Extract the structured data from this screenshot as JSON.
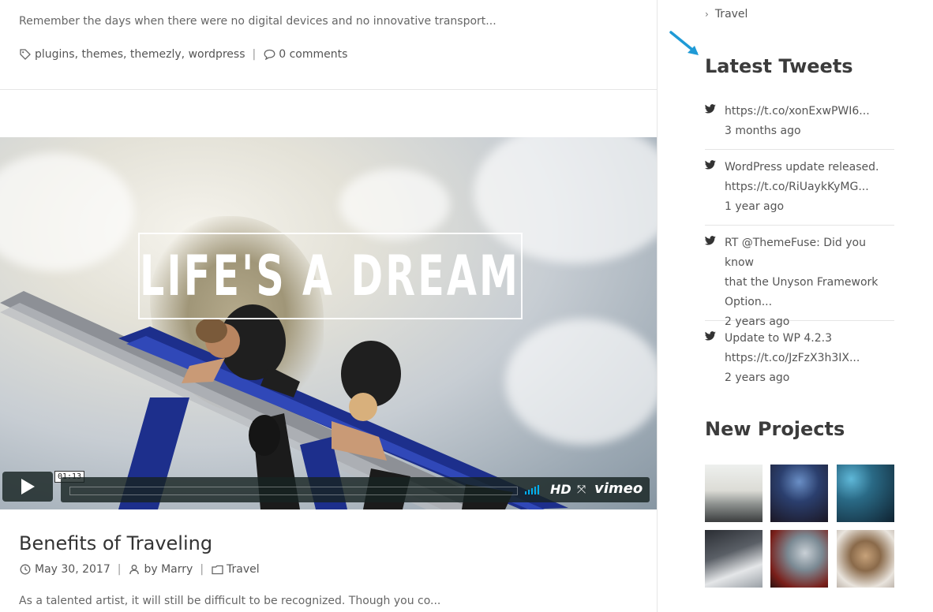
{
  "top_post": {
    "excerpt": "Remember the days when there were no digital devices and no innovative transport...",
    "tags": "plugins, themes, themezly, wordpress",
    "comments": "0 comments"
  },
  "video": {
    "overlay_title": "LIFE'S A DREAM",
    "timecode": "01:13",
    "hd_label": "HD",
    "brand": "vimeo"
  },
  "post": {
    "title": "Benefits of Traveling",
    "date": "May 30, 2017",
    "author": "by Marry",
    "category": "Travel",
    "excerpt": "As a talented artist, it will still be difficult to be recognized. Though you co..."
  },
  "sidebar": {
    "category_item": "Travel",
    "tweets_title": "Latest Tweets",
    "tweets": [
      {
        "lines": [
          "https://t.co/xonExwPWI6..."
        ],
        "time": "3 months ago"
      },
      {
        "lines": [
          "WordPress update released.",
          "https://t.co/RiUaykKyMG..."
        ],
        "time": "1 year ago"
      },
      {
        "lines": [
          "RT @ThemeFuse: Did you know",
          "that the Unyson Framework",
          "Option..."
        ],
        "time": "2 years ago"
      },
      {
        "lines": [
          "Update to WP 4.2.3",
          "https://t.co/JzFzX3h3IX..."
        ],
        "time": "2 years ago"
      }
    ],
    "projects_title": "New Projects"
  },
  "colors": {
    "accent_arrow": "#1f9ad6",
    "player_bg": "#172322",
    "volume": "#00adef"
  }
}
